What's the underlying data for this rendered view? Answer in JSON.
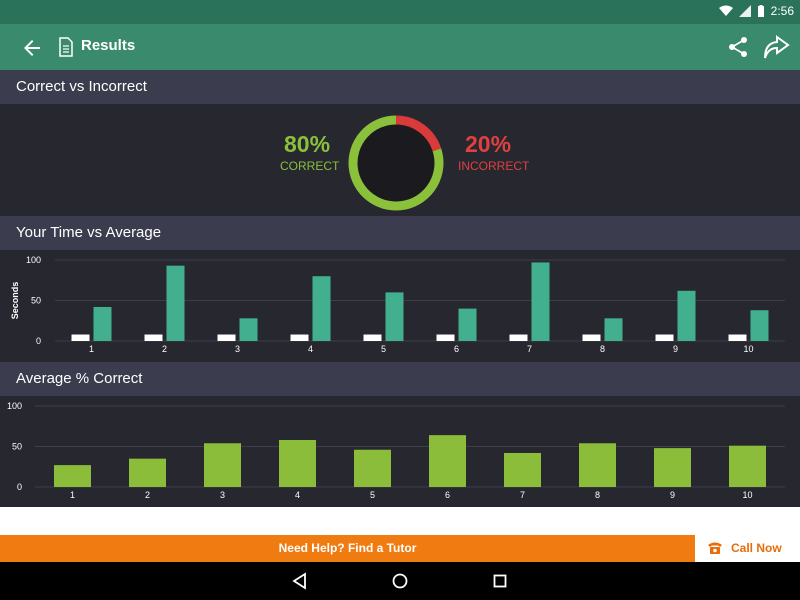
{
  "status_bar": {
    "time": "2:56"
  },
  "app_bar": {
    "title": "Results",
    "back_icon": "arrow-back-icon",
    "doc_icon": "document-icon",
    "share_icon": "share-icon",
    "forward_icon": "forward-icon"
  },
  "sections": {
    "correct_vs_incorrect": "Correct vs Incorrect",
    "time_vs_average": "Your Time vs Average",
    "average_correct": "Average % Correct"
  },
  "summary": {
    "correct_pct": "80%",
    "correct_label": "CORRECT",
    "incorrect_pct": "20%",
    "incorrect_label": "INCORRECT",
    "correct_fraction": 0.8,
    "incorrect_fraction": 0.2,
    "colors": {
      "correct": "#8bc03b",
      "incorrect": "#d93a3a",
      "center": "#1b1b1f"
    }
  },
  "chart_data": [
    {
      "type": "bar",
      "categories": [
        "1",
        "2",
        "3",
        "4",
        "5",
        "6",
        "7",
        "8",
        "9",
        "10"
      ],
      "ylabel": "Seconds",
      "ylim": [
        0,
        100
      ],
      "yticks": [
        0,
        50,
        100
      ],
      "series": [
        {
          "values": [
            8,
            8,
            8,
            8,
            8,
            8,
            8,
            8,
            8,
            8
          ],
          "color": "#ffffff"
        },
        {
          "values": [
            42,
            93,
            28,
            80,
            60,
            40,
            97,
            28,
            62,
            38
          ],
          "color": "#42b08e"
        }
      ]
    },
    {
      "type": "bar",
      "categories": [
        "1",
        "2",
        "3",
        "4",
        "5",
        "6",
        "7",
        "8",
        "9",
        "10"
      ],
      "ylim": [
        0,
        100
      ],
      "yticks": [
        0,
        50,
        100
      ],
      "series": [
        {
          "values": [
            27,
            35,
            54,
            58,
            46,
            64,
            42,
            54,
            48,
            51
          ],
          "color": "#8bbd3a"
        }
      ]
    }
  ],
  "tutor_bar": {
    "help_text": "Need Help? Find a Tutor",
    "call_label": "Call Now",
    "phone_icon": "phone-icon"
  },
  "nav_bar": {
    "back": "nav-back-icon",
    "home": "nav-home-icon",
    "recents": "nav-recents-icon"
  }
}
